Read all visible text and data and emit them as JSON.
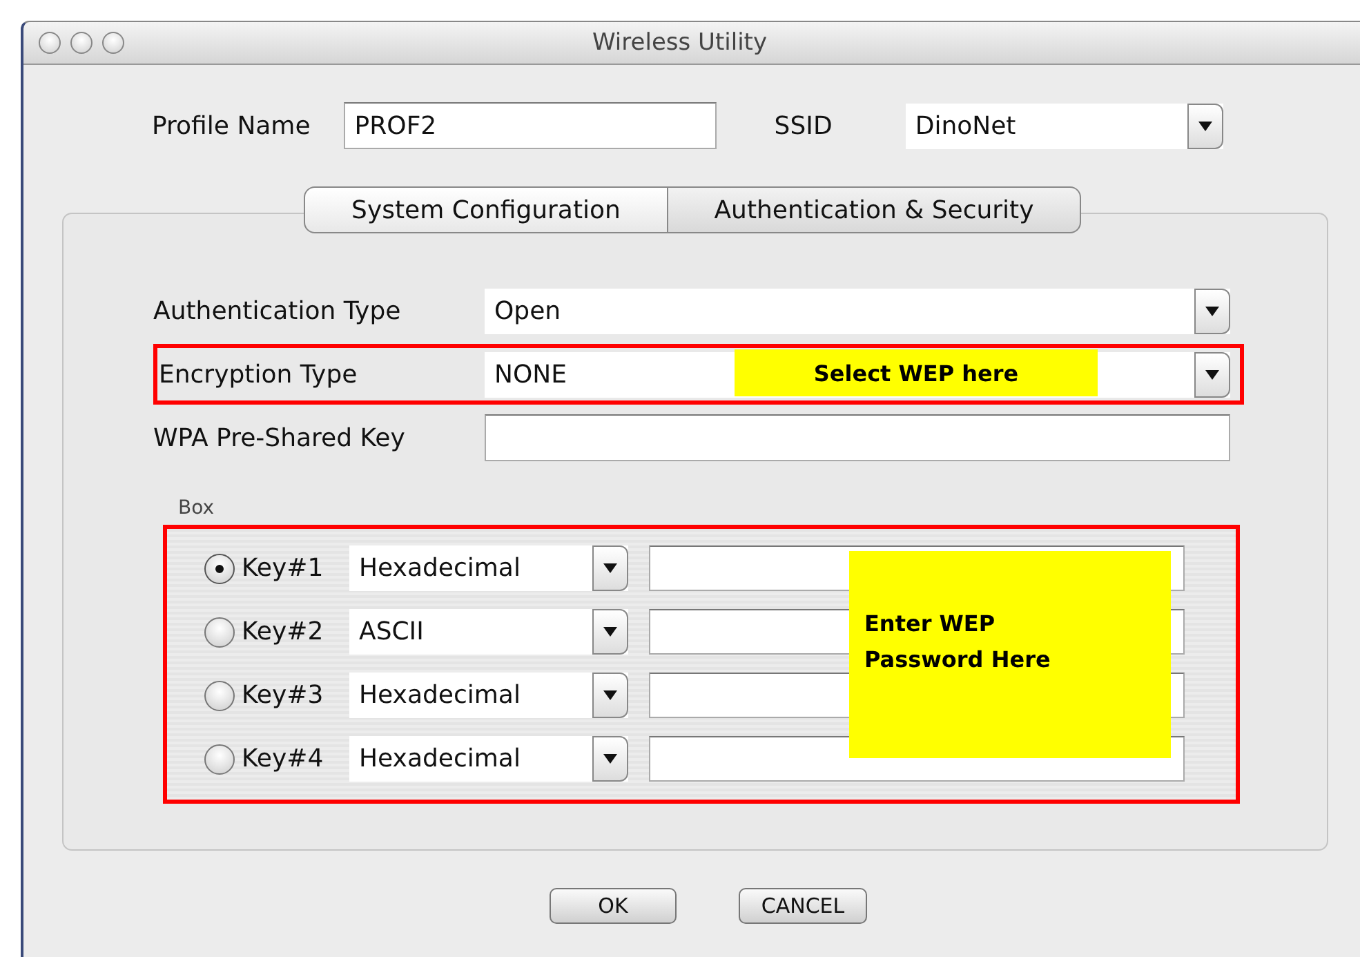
{
  "window": {
    "title": "Wireless Utility"
  },
  "profile": {
    "name_label": "Profile Name",
    "name": "PROF2",
    "ssid_label": "SSID",
    "ssid": "DinoNet"
  },
  "tabs": [
    {
      "label": "System Configuration",
      "selected": false
    },
    {
      "label": "Authentication & Security",
      "selected": true
    }
  ],
  "settings": [
    {
      "label": "Authentication Type",
      "kind": "dropdown",
      "value": "Open",
      "highlighted": false
    },
    {
      "label": "Encryption Type",
      "kind": "dropdown",
      "value": "NONE",
      "highlighted": true
    },
    {
      "label": "WPA Pre-Shared Key",
      "kind": "text",
      "highlighted": false
    }
  ],
  "key_box": {
    "title": "Box",
    "highlighted": true,
    "keys": [
      {
        "label": "Key#1",
        "selected": true,
        "format": "Hexadecimal"
      },
      {
        "label": "Key#2",
        "selected": false,
        "format": "ASCII"
      },
      {
        "label": "Key#3",
        "selected": false,
        "format": "Hexadecimal"
      },
      {
        "label": "Key#4",
        "selected": false,
        "format": "Hexadecimal"
      }
    ]
  },
  "annotations": [
    {
      "kind": "encryption",
      "text": "Select WEP here"
    },
    {
      "kind": "password",
      "text": "Enter WEP Password Here"
    }
  ],
  "buttons": [
    "OK",
    "CANCEL"
  ]
}
